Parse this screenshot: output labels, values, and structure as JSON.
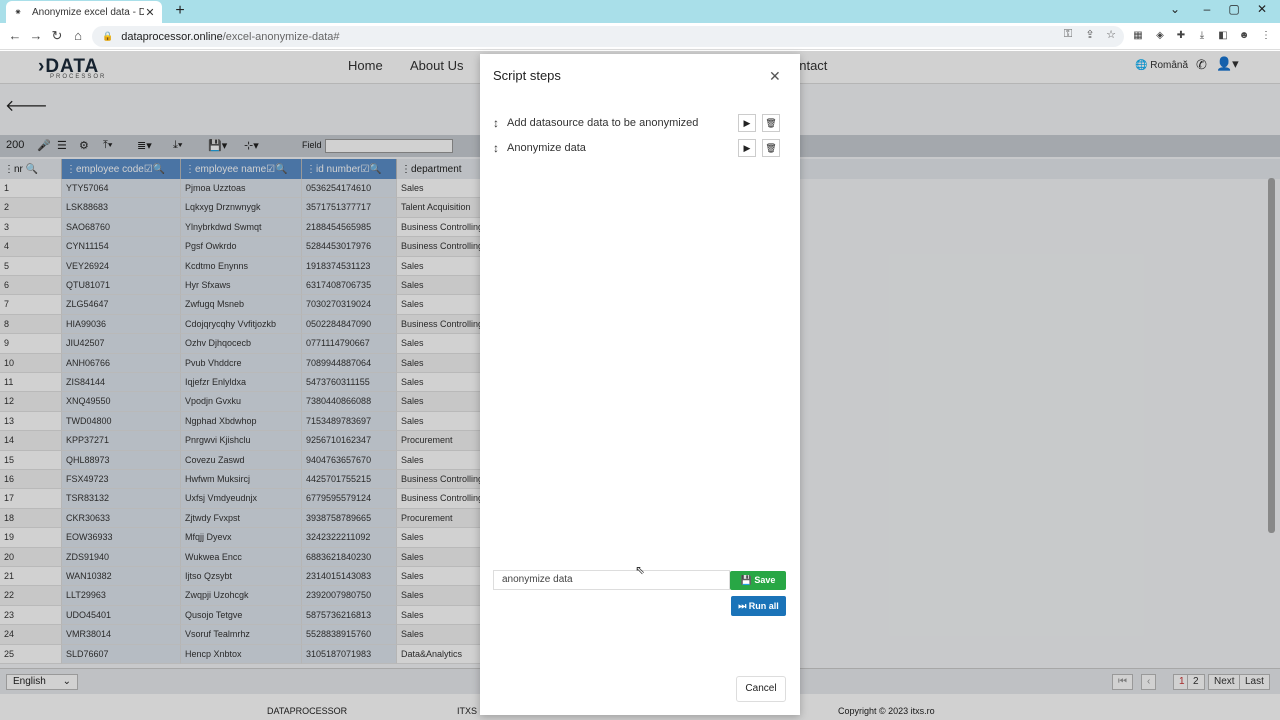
{
  "browser": {
    "tab_title": "Anonymize excel data - DataPro",
    "url_host": "dataprocessor.online",
    "url_path": "/excel-anonymize-data#"
  },
  "app": {
    "nav": [
      "Home",
      "About Us",
      "ontact"
    ],
    "language_top": "Română",
    "toolbar_count": "200",
    "field_label": "Field"
  },
  "grid": {
    "columns": [
      "nr",
      "employee code",
      "employee name",
      "id number",
      "department"
    ],
    "rows": [
      [
        "1",
        "YTY57064",
        "Pjmoa Uzztoas",
        "0536254174610",
        "Sales"
      ],
      [
        "2",
        "LSK88683",
        "Lqkxyg Drznwnygk",
        "3571751377717",
        "Talent Acquisition"
      ],
      [
        "3",
        "SAO68760",
        "Ylnybrkdwd Swmqt",
        "2188454565985",
        "Business Controlling"
      ],
      [
        "4",
        "CYN11154",
        "Pgsf Owkrdo",
        "5284453017976",
        "Business Controlling"
      ],
      [
        "5",
        "VEY26924",
        "Kcdtmo Enynns",
        "1918374531123",
        "Sales"
      ],
      [
        "6",
        "QTU81071",
        "Hyr Sfxaws",
        "6317408706735",
        "Sales"
      ],
      [
        "7",
        "ZLG54647",
        "Zwfugq Msneb",
        "7030270319024",
        "Sales"
      ],
      [
        "8",
        "HIA99036",
        "Cdojqrycqhy Vvfitjozkb",
        "0502284847090",
        "Business Controlling"
      ],
      [
        "9",
        "JIU42507",
        "Ozhv Djhqocecb",
        "0771114790667",
        "Sales"
      ],
      [
        "10",
        "ANH06766",
        "Pvub Vhddcre",
        "7089944887064",
        "Sales"
      ],
      [
        "11",
        "ZIS84144",
        "Iqjefzr Enlyldxa",
        "5473760311155",
        "Sales"
      ],
      [
        "12",
        "XNQ49550",
        "Vpodjn Gvxku",
        "7380440866088",
        "Sales"
      ],
      [
        "13",
        "TWD04800",
        "Ngphad Xbdwhop",
        "7153489783697",
        "Sales"
      ],
      [
        "14",
        "KPP37271",
        "Pnrgwvi Kjishclu",
        "9256710162347",
        "Procurement"
      ],
      [
        "15",
        "QHL88973",
        "Covezu Zaswd",
        "9404763657670",
        "Sales"
      ],
      [
        "16",
        "FSX49723",
        "Hwfwm Muksircj",
        "4425701755215",
        "Business Controlling"
      ],
      [
        "17",
        "TSR83132",
        "Uxfsj Vmdyeudnjx",
        "6779595579124",
        "Business Controlling"
      ],
      [
        "18",
        "CKR30633",
        "Zjtwdy Fvxpst",
        "3938758789665",
        "Procurement"
      ],
      [
        "19",
        "EOW36933",
        "Mfqjj Dyevx",
        "3242322211092",
        "Sales"
      ],
      [
        "20",
        "ZDS91940",
        "Wukwea Encc",
        "6883621840230",
        "Sales"
      ],
      [
        "21",
        "WAN10382",
        "Ijtso Qzsybt",
        "2314015143083",
        "Sales"
      ],
      [
        "22",
        "LLT29963",
        "Zwqpji Uzohcgk",
        "2392007980750",
        "Sales"
      ],
      [
        "23",
        "UDO45401",
        "Qusojo Tetgve",
        "5875736216813",
        "Sales"
      ],
      [
        "24",
        "VMR38014",
        "Vsoruf Tealmrhz",
        "5528838915760",
        "Sales"
      ],
      [
        "25",
        "SLD76607",
        "Hencp Xnbtox",
        "3105187071983",
        "Data&Analytics"
      ]
    ]
  },
  "footer": {
    "language": "English",
    "pages": [
      "1",
      "2"
    ],
    "next": "Next",
    "last": "Last",
    "brand": "DATAPROCESSOR",
    "itxs": "ITXS",
    "copyright": "Copyright © 2023 itxs.ro"
  },
  "modal": {
    "title": "Script steps",
    "steps": [
      "Add datasource data to be anonymized",
      "Anonymize data"
    ],
    "script_name": "anonymize data",
    "save_label": "Save",
    "run_all_label": "Run all",
    "cancel_label": "Cancel"
  }
}
